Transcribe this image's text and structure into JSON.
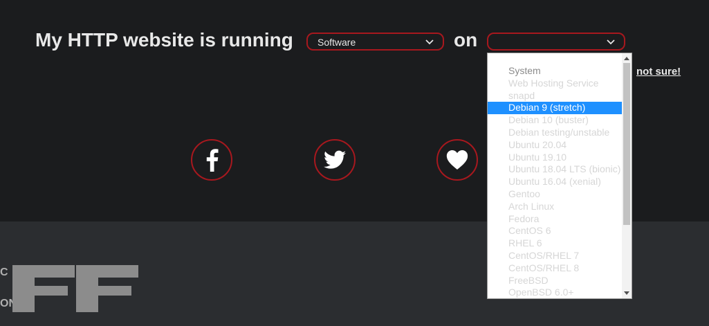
{
  "headline": {
    "text": "My HTTP website is running",
    "on": "on"
  },
  "software_select": {
    "value": "Software"
  },
  "os_select": {
    "value": ""
  },
  "help_link": "not sure!",
  "social": {
    "facebook_icon": "facebook-icon",
    "twitter_icon": "twitter-icon",
    "heart_icon": "heart-icon"
  },
  "dropdown": {
    "header": "System",
    "options": [
      "Web Hosting Service",
      "snapd",
      "Debian 9 (stretch)",
      "Debian 10 (buster)",
      "Debian testing/unstable",
      "Ubuntu 20.04",
      "Ubuntu 19.10",
      "Ubuntu 18.04 LTS (bionic)",
      "Ubuntu 16.04 (xenial)",
      "Gentoo",
      "Arch Linux",
      "Fedora",
      "CentOS 6",
      "RHEL 6",
      "CentOS/RHEL 7",
      "CentOS/RHEL 8",
      "FreeBSD",
      "OpenBSD 6.0+"
    ],
    "selected": "Debian 9 (stretch)"
  },
  "footer_logo": {
    "left_top": "C",
    "left_bottom": "ON"
  },
  "colors": {
    "background": "#1b1c1e",
    "footer": "#2b2d30",
    "accent": "#a8181e",
    "selected": "#1e90ff"
  }
}
